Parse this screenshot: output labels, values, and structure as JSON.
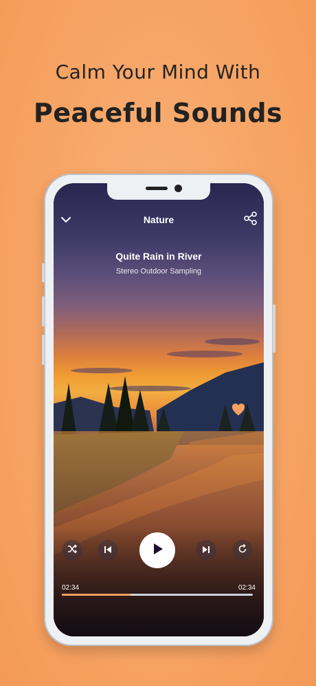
{
  "headline": {
    "line1": "Calm Your Mind With",
    "line2": "Peaceful Sounds"
  },
  "player": {
    "category": "Nature",
    "track_title": "Quite Rain in River",
    "track_subtitle": "Stereo Outdoor Sampling",
    "elapsed": "02:34",
    "duration": "02:34",
    "progress_fraction": 0.36
  },
  "icons": {
    "collapse": "chevron-down-icon",
    "share": "share-icon",
    "favorite": "heart-icon",
    "shuffle": "shuffle-icon",
    "previous": "skip-previous-icon",
    "play": "play-icon",
    "next": "skip-next-icon",
    "repeat": "repeat-icon"
  },
  "colors": {
    "background": "#f6a160",
    "accent": "#f6a160",
    "text": "#222222"
  }
}
